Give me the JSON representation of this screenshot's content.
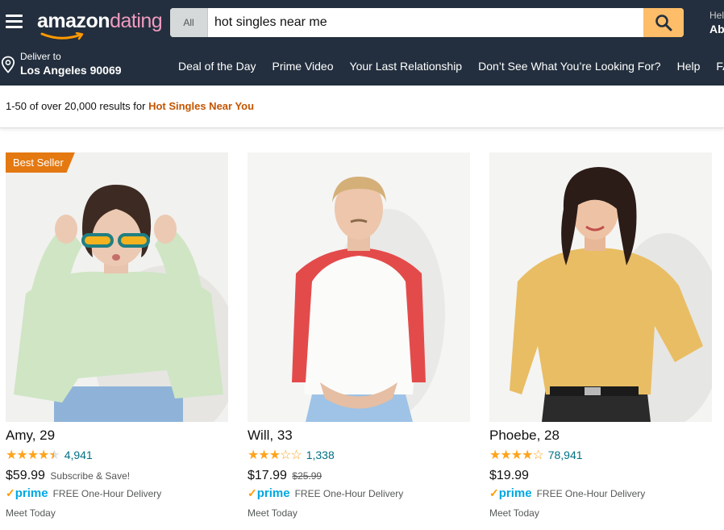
{
  "header": {
    "logo_part1": "amazon",
    "logo_part2": "dating",
    "search_category": "All",
    "search_value": "hot singles near me",
    "account_line1": "Hello",
    "account_line2": "Ab"
  },
  "nav": {
    "deliver_label": "Deliver to",
    "deliver_location": "Los Angeles 90069",
    "links": [
      "Deal of the Day",
      "Prime Video",
      "Your Last Relationship",
      "Don’t See What You’re Looking For?",
      "Help",
      "FAQ"
    ]
  },
  "results": {
    "summary": "1-50 of over 20,000 results for",
    "query": "Hot Singles Near You"
  },
  "products": [
    {
      "badge": "Best Seller",
      "name": "Amy, 29",
      "rating": 4.5,
      "reviews": "4,941",
      "price": "$59.99",
      "price_note": "Subscribe & Save!",
      "prime_text": "FREE One-Hour Delivery",
      "meet": "Meet Today"
    },
    {
      "badge": "",
      "name": "Will, 33",
      "rating": 3,
      "reviews": "1,338",
      "price": "$17.99",
      "price_old": "$25.99",
      "prime_text": "FREE One-Hour Delivery",
      "meet": "Meet Today"
    },
    {
      "badge": "",
      "name": "Phoebe, 28",
      "rating": 4,
      "reviews": "78,941",
      "price": "$19.99",
      "prime_text": "FREE One-Hour Delivery",
      "meet": "Meet Today"
    }
  ],
  "prime_logo": "prime",
  "colors": {
    "header_bg": "#232f3e",
    "search_button": "#febd69",
    "badge": "#e47911",
    "link": "#007185",
    "query": "#c45500",
    "star": "#ffa41c",
    "prime": "#00a8e1"
  }
}
